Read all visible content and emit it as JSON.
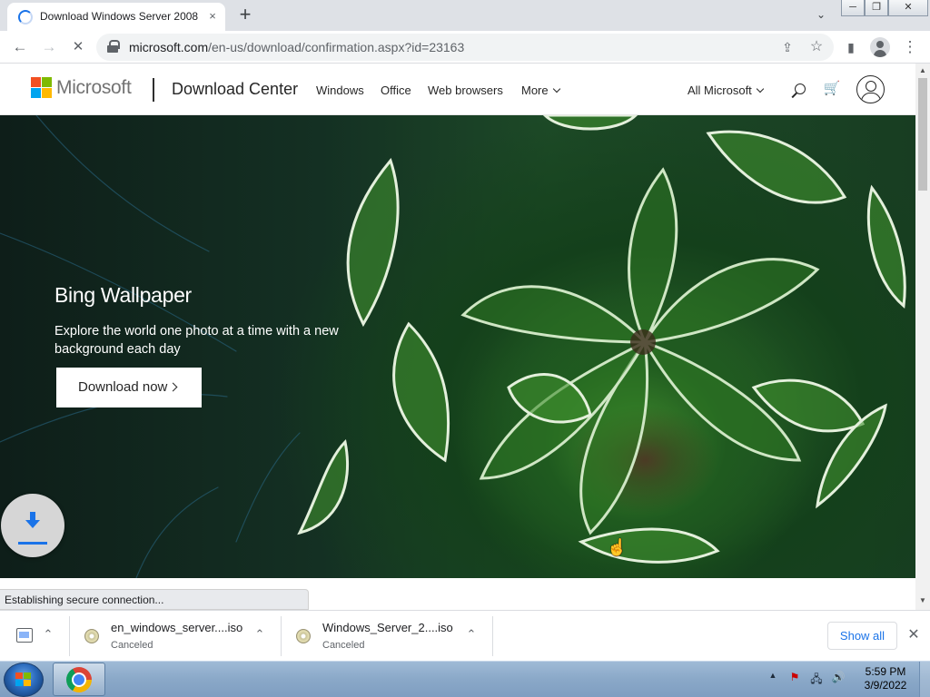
{
  "browser": {
    "tab": {
      "title": "Download Windows Server 2008",
      "close_icon": "×"
    },
    "new_tab_icon": "+",
    "tab_search_icon": "⌄",
    "window_controls": {
      "minimize": "─",
      "maximize": "❐",
      "close": "✕"
    },
    "nav": {
      "back_icon": "←",
      "forward_icon": "→",
      "stop_icon": "✕"
    },
    "address": {
      "host": "microsoft.com",
      "path": "/en-us/download/confirmation.aspx?id=23163"
    },
    "share_icon": "⇪",
    "bookmark_icon": "☆",
    "sidepanel_icon": "▮",
    "menu_icon": "⋮"
  },
  "page": {
    "header": {
      "brand": "Microsoft",
      "site_name": "Download Center",
      "nav": [
        {
          "label": "Windows"
        },
        {
          "label": "Office"
        },
        {
          "label": "Web browsers"
        },
        {
          "label": "More"
        }
      ],
      "all_microsoft": "All Microsoft",
      "cart_icon": "🛒",
      "logo_colors": [
        "#f25022",
        "#7fba00",
        "#00a4ef",
        "#ffb900"
      ]
    },
    "hero": {
      "title": "Bing Wallpaper",
      "text": "Explore the world one photo at a time with a new background each day",
      "button": "Download now"
    },
    "status": "Establishing secure connection..."
  },
  "downloads": {
    "items": [
      {
        "name": "en_windows_server....iso",
        "state": "Canceled"
      },
      {
        "name": "Windows_Server_2....iso",
        "state": "Canceled"
      }
    ],
    "show_all": "Show all",
    "close_icon": "✕",
    "chevron_icon": "⌃"
  },
  "taskbar": {
    "time": "5:59 PM",
    "date": "3/9/2022",
    "tray_icons": [
      "show-hidden-icons",
      "action-center-icon",
      "network-icon",
      "volume-icon"
    ],
    "tray_glyphs": {
      "arrow": "▲",
      "flag": "⚑",
      "network": "🖧",
      "volume": "🔊"
    },
    "start_colors": [
      "#f25022",
      "#7fba00",
      "#00a4ef",
      "#ffb900"
    ]
  }
}
